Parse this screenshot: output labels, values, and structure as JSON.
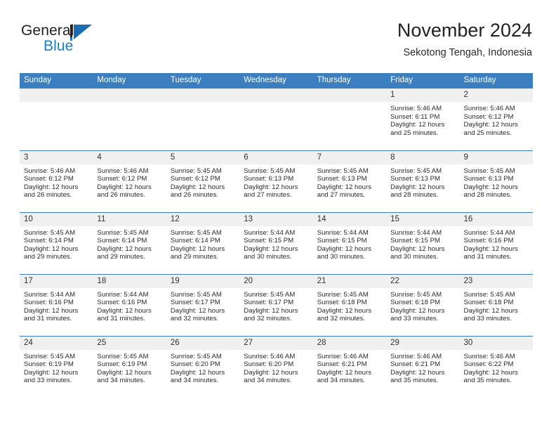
{
  "brand": {
    "word_one": "General",
    "word_two": "Blue",
    "mark": "triangle-flag-icon"
  },
  "header": {
    "month_title": "November 2024",
    "location": "Sekotong Tengah, Indonesia"
  },
  "colors": {
    "header_blue": "#3b7fc0",
    "brand_blue": "#1b7fc4",
    "daynum_band": "#f0f0f0",
    "text": "#2b2b2b"
  },
  "calendar": {
    "weekday_headers": [
      "Sunday",
      "Monday",
      "Tuesday",
      "Wednesday",
      "Thursday",
      "Friday",
      "Saturday"
    ],
    "labels": {
      "sunrise": "Sunrise:",
      "sunset": "Sunset:",
      "daylight": "Daylight:"
    },
    "weeks": [
      [
        {
          "day": "",
          "sunrise": "",
          "sunset": "",
          "daylight_line1": "",
          "daylight_line2": ""
        },
        {
          "day": "",
          "sunrise": "",
          "sunset": "",
          "daylight_line1": "",
          "daylight_line2": ""
        },
        {
          "day": "",
          "sunrise": "",
          "sunset": "",
          "daylight_line1": "",
          "daylight_line2": ""
        },
        {
          "day": "",
          "sunrise": "",
          "sunset": "",
          "daylight_line1": "",
          "daylight_line2": ""
        },
        {
          "day": "",
          "sunrise": "",
          "sunset": "",
          "daylight_line1": "",
          "daylight_line2": ""
        },
        {
          "day": "1",
          "sunrise": "Sunrise: 5:46 AM",
          "sunset": "Sunset: 6:11 PM",
          "daylight_line1": "Daylight: 12 hours",
          "daylight_line2": "and 25 minutes."
        },
        {
          "day": "2",
          "sunrise": "Sunrise: 5:46 AM",
          "sunset": "Sunset: 6:12 PM",
          "daylight_line1": "Daylight: 12 hours",
          "daylight_line2": "and 25 minutes."
        }
      ],
      [
        {
          "day": "3",
          "sunrise": "Sunrise: 5:46 AM",
          "sunset": "Sunset: 6:12 PM",
          "daylight_line1": "Daylight: 12 hours",
          "daylight_line2": "and 26 minutes."
        },
        {
          "day": "4",
          "sunrise": "Sunrise: 5:46 AM",
          "sunset": "Sunset: 6:12 PM",
          "daylight_line1": "Daylight: 12 hours",
          "daylight_line2": "and 26 minutes."
        },
        {
          "day": "5",
          "sunrise": "Sunrise: 5:45 AM",
          "sunset": "Sunset: 6:12 PM",
          "daylight_line1": "Daylight: 12 hours",
          "daylight_line2": "and 26 minutes."
        },
        {
          "day": "6",
          "sunrise": "Sunrise: 5:45 AM",
          "sunset": "Sunset: 6:13 PM",
          "daylight_line1": "Daylight: 12 hours",
          "daylight_line2": "and 27 minutes."
        },
        {
          "day": "7",
          "sunrise": "Sunrise: 5:45 AM",
          "sunset": "Sunset: 6:13 PM",
          "daylight_line1": "Daylight: 12 hours",
          "daylight_line2": "and 27 minutes."
        },
        {
          "day": "8",
          "sunrise": "Sunrise: 5:45 AM",
          "sunset": "Sunset: 6:13 PM",
          "daylight_line1": "Daylight: 12 hours",
          "daylight_line2": "and 28 minutes."
        },
        {
          "day": "9",
          "sunrise": "Sunrise: 5:45 AM",
          "sunset": "Sunset: 6:13 PM",
          "daylight_line1": "Daylight: 12 hours",
          "daylight_line2": "and 28 minutes."
        }
      ],
      [
        {
          "day": "10",
          "sunrise": "Sunrise: 5:45 AM",
          "sunset": "Sunset: 6:14 PM",
          "daylight_line1": "Daylight: 12 hours",
          "daylight_line2": "and 29 minutes."
        },
        {
          "day": "11",
          "sunrise": "Sunrise: 5:45 AM",
          "sunset": "Sunset: 6:14 PM",
          "daylight_line1": "Daylight: 12 hours",
          "daylight_line2": "and 29 minutes."
        },
        {
          "day": "12",
          "sunrise": "Sunrise: 5:45 AM",
          "sunset": "Sunset: 6:14 PM",
          "daylight_line1": "Daylight: 12 hours",
          "daylight_line2": "and 29 minutes."
        },
        {
          "day": "13",
          "sunrise": "Sunrise: 5:44 AM",
          "sunset": "Sunset: 6:15 PM",
          "daylight_line1": "Daylight: 12 hours",
          "daylight_line2": "and 30 minutes."
        },
        {
          "day": "14",
          "sunrise": "Sunrise: 5:44 AM",
          "sunset": "Sunset: 6:15 PM",
          "daylight_line1": "Daylight: 12 hours",
          "daylight_line2": "and 30 minutes."
        },
        {
          "day": "15",
          "sunrise": "Sunrise: 5:44 AM",
          "sunset": "Sunset: 6:15 PM",
          "daylight_line1": "Daylight: 12 hours",
          "daylight_line2": "and 30 minutes."
        },
        {
          "day": "16",
          "sunrise": "Sunrise: 5:44 AM",
          "sunset": "Sunset: 6:16 PM",
          "daylight_line1": "Daylight: 12 hours",
          "daylight_line2": "and 31 minutes."
        }
      ],
      [
        {
          "day": "17",
          "sunrise": "Sunrise: 5:44 AM",
          "sunset": "Sunset: 6:16 PM",
          "daylight_line1": "Daylight: 12 hours",
          "daylight_line2": "and 31 minutes."
        },
        {
          "day": "18",
          "sunrise": "Sunrise: 5:44 AM",
          "sunset": "Sunset: 6:16 PM",
          "daylight_line1": "Daylight: 12 hours",
          "daylight_line2": "and 31 minutes."
        },
        {
          "day": "19",
          "sunrise": "Sunrise: 5:45 AM",
          "sunset": "Sunset: 6:17 PM",
          "daylight_line1": "Daylight: 12 hours",
          "daylight_line2": "and 32 minutes."
        },
        {
          "day": "20",
          "sunrise": "Sunrise: 5:45 AM",
          "sunset": "Sunset: 6:17 PM",
          "daylight_line1": "Daylight: 12 hours",
          "daylight_line2": "and 32 minutes."
        },
        {
          "day": "21",
          "sunrise": "Sunrise: 5:45 AM",
          "sunset": "Sunset: 6:18 PM",
          "daylight_line1": "Daylight: 12 hours",
          "daylight_line2": "and 32 minutes."
        },
        {
          "day": "22",
          "sunrise": "Sunrise: 5:45 AM",
          "sunset": "Sunset: 6:18 PM",
          "daylight_line1": "Daylight: 12 hours",
          "daylight_line2": "and 33 minutes."
        },
        {
          "day": "23",
          "sunrise": "Sunrise: 5:45 AM",
          "sunset": "Sunset: 6:18 PM",
          "daylight_line1": "Daylight: 12 hours",
          "daylight_line2": "and 33 minutes."
        }
      ],
      [
        {
          "day": "24",
          "sunrise": "Sunrise: 5:45 AM",
          "sunset": "Sunset: 6:19 PM",
          "daylight_line1": "Daylight: 12 hours",
          "daylight_line2": "and 33 minutes."
        },
        {
          "day": "25",
          "sunrise": "Sunrise: 5:45 AM",
          "sunset": "Sunset: 6:19 PM",
          "daylight_line1": "Daylight: 12 hours",
          "daylight_line2": "and 34 minutes."
        },
        {
          "day": "26",
          "sunrise": "Sunrise: 5:45 AM",
          "sunset": "Sunset: 6:20 PM",
          "daylight_line1": "Daylight: 12 hours",
          "daylight_line2": "and 34 minutes."
        },
        {
          "day": "27",
          "sunrise": "Sunrise: 5:46 AM",
          "sunset": "Sunset: 6:20 PM",
          "daylight_line1": "Daylight: 12 hours",
          "daylight_line2": "and 34 minutes."
        },
        {
          "day": "28",
          "sunrise": "Sunrise: 5:46 AM",
          "sunset": "Sunset: 6:21 PM",
          "daylight_line1": "Daylight: 12 hours",
          "daylight_line2": "and 34 minutes."
        },
        {
          "day": "29",
          "sunrise": "Sunrise: 5:46 AM",
          "sunset": "Sunset: 6:21 PM",
          "daylight_line1": "Daylight: 12 hours",
          "daylight_line2": "and 35 minutes."
        },
        {
          "day": "30",
          "sunrise": "Sunrise: 5:46 AM",
          "sunset": "Sunset: 6:22 PM",
          "daylight_line1": "Daylight: 12 hours",
          "daylight_line2": "and 35 minutes."
        }
      ]
    ]
  }
}
